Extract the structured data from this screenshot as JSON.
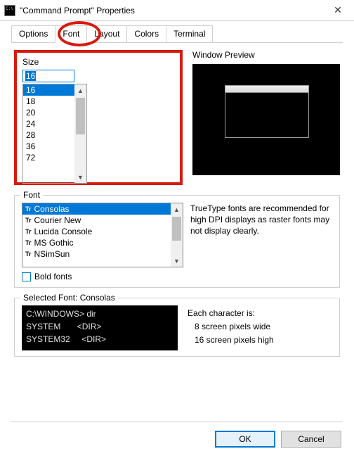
{
  "window": {
    "title": "\"Command Prompt\" Properties"
  },
  "tabs": [
    "Options",
    "Font",
    "Layout",
    "Colors",
    "Terminal"
  ],
  "active_tab": 1,
  "size": {
    "label": "Size",
    "value": "16",
    "options": [
      "16",
      "18",
      "20",
      "24",
      "28",
      "36",
      "72"
    ]
  },
  "preview": {
    "label": "Window Preview"
  },
  "font": {
    "legend": "Font",
    "items": [
      "Consolas",
      "Courier New",
      "Lucida Console",
      "MS Gothic",
      "NSimSun"
    ],
    "selected": 0,
    "description": "TrueType fonts are recommended for high DPI displays as raster fonts may not display clearly.",
    "bold_label": "Bold fonts"
  },
  "selected_font": {
    "legend": "Selected Font: Consolas",
    "sample_lines": [
      "C:\\WINDOWS> dir",
      "SYSTEM       <DIR>",
      "SYSTEM32     <DIR>"
    ],
    "intro": "Each character is:",
    "width_line": "8 screen pixels wide",
    "height_line": "16 screen pixels high"
  },
  "buttons": {
    "ok": "OK",
    "cancel": "Cancel"
  }
}
